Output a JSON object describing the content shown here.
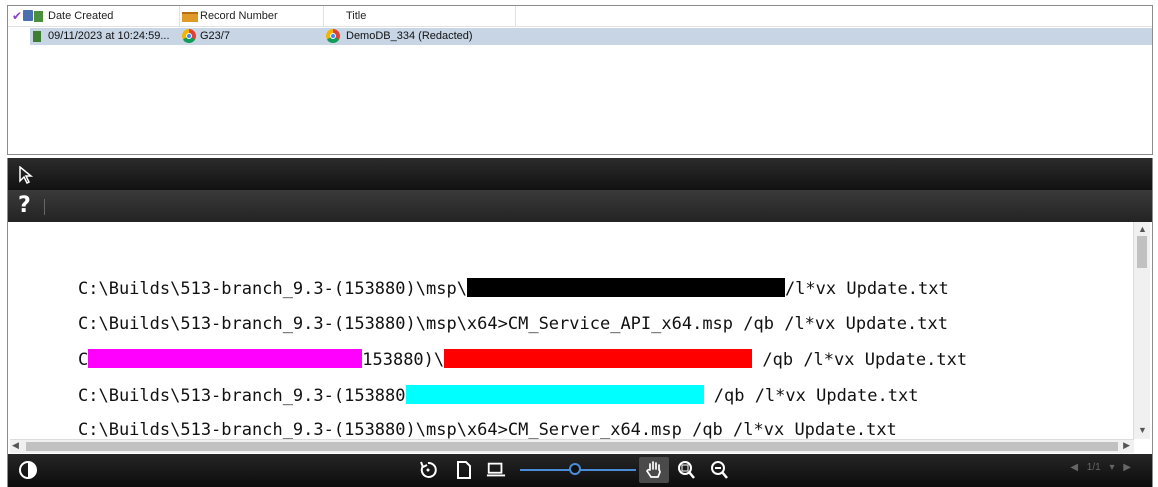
{
  "list": {
    "columns": {
      "date_created": "Date Created",
      "record_number": "Record Number",
      "title": "Title"
    },
    "rows": [
      {
        "date_created": "09/11/2023 at 10:24:59...",
        "record_number": "G23/7",
        "title": "DemoDB_334 (Redacted)"
      }
    ],
    "selected_row_color": "#c7d5e5"
  },
  "viewer": {
    "lines": [
      {
        "prefix": "C:\\Builds\\513-branch_9.3-(153880)\\msp\\",
        "suffix": "/l*vx Update.txt"
      },
      {
        "text": "C:\\Builds\\513-branch_9.3-(153880)\\msp\\x64>CM_Service_API_x64.msp /qb /l*vx Update.txt"
      },
      {
        "prefix": "C",
        "middle": "153880)\\",
        "suffix": " /qb /l*vx Update.txt"
      },
      {
        "prefix": "C:\\Builds\\513-branch_9.3-(153880",
        "suffix": " /qb /l*vx Update.txt"
      },
      {
        "text": "C:\\Builds\\513-branch_9.3-(153880)\\msp\\x64>CM_Server_x64.msp /qb /l*vx Update.txt"
      }
    ],
    "redaction_colors": {
      "black": "#000000",
      "magenta": "#ff00ff",
      "red": "#ff0000",
      "cyan": "#00ffff"
    },
    "help_label": "?",
    "page_indicator": "1/1"
  },
  "icons": {
    "top_toolbar": [
      "pointer-icon"
    ],
    "bottom_toolbar": [
      "contrast-icon",
      "rotate-icon",
      "page-icon",
      "fit-width-icon",
      "zoom-slider",
      "hand-icon",
      "zoom-region-icon",
      "zoom-out-icon",
      "prev-page-icon",
      "next-page-icon"
    ]
  }
}
